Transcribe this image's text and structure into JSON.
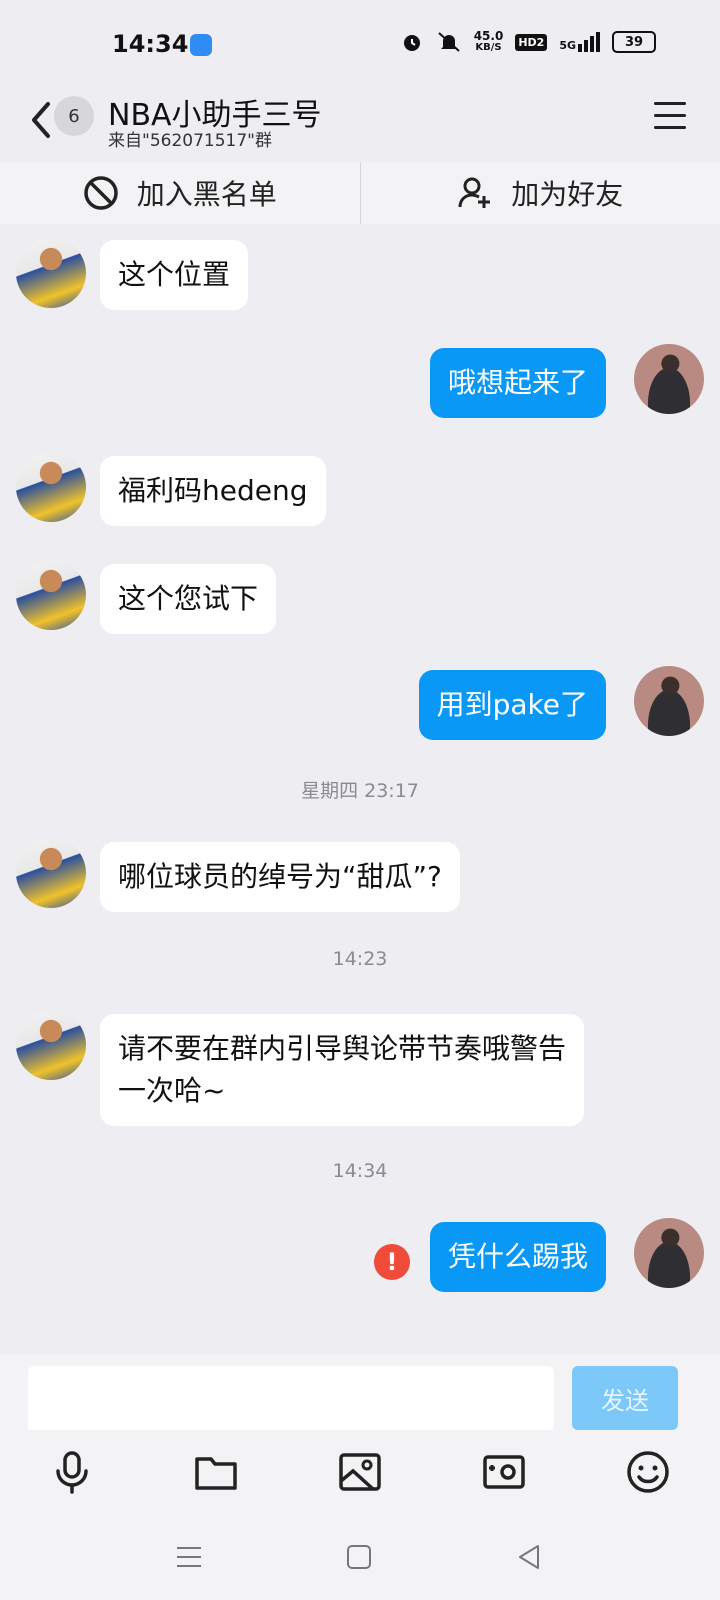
{
  "status_bar": {
    "time": "14:34",
    "net_speed_value": "45.0",
    "net_speed_unit": "KB/S",
    "hd_label": "HD2",
    "signal_label": "5G",
    "battery": "39"
  },
  "header": {
    "unread_count": "6",
    "title": "NBA小助手三号",
    "subtitle": "来自\"562071517\"群"
  },
  "actions": {
    "blacklist_label": "加入黑名单",
    "add_friend_label": "加为好友"
  },
  "messages": [
    {
      "side": "left",
      "text": "这个位置"
    },
    {
      "side": "right",
      "text": "哦想起来了"
    },
    {
      "side": "left",
      "text": "福利码hedeng"
    },
    {
      "side": "left",
      "text": "这个您试下"
    },
    {
      "side": "right",
      "text": "用到pake了"
    },
    {
      "side": "time",
      "text": "星期四 23:17"
    },
    {
      "side": "left",
      "text": "哪位球员的绰号为“甜瓜”?"
    },
    {
      "side": "time",
      "text": "14:23"
    },
    {
      "side": "left",
      "text": "请不要在群内引导舆论带节奏哦警告一次哈~"
    },
    {
      "side": "time",
      "text": "14:34"
    },
    {
      "side": "right",
      "text": "凭什么踢我",
      "failed": true,
      "error_mark": "!"
    }
  ],
  "composer": {
    "placeholder": "",
    "send_label": "发送"
  },
  "toolbar_icons": [
    "microphone-icon",
    "folder-icon",
    "image-icon",
    "camera-icon",
    "emoji-icon"
  ],
  "nav_icons": [
    "menu-icon",
    "home-icon",
    "back-icon"
  ],
  "colors": {
    "accent": "#0a98f6",
    "background": "#ededf2",
    "error": "#f04a3a"
  }
}
